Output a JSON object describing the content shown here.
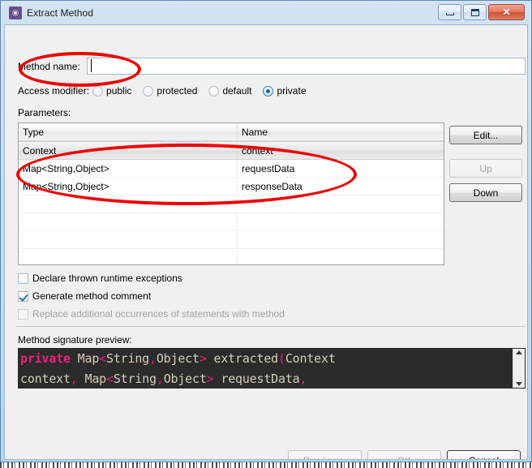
{
  "window": {
    "title": "Extract Method",
    "icon": "refactor-gear-icon",
    "controls": {
      "minimize_label": "–",
      "maximize_label": "□",
      "close_label": "✕"
    }
  },
  "method_name": {
    "label": "Method name:",
    "value": "",
    "placeholder": ""
  },
  "access_modifier": {
    "label": "Access modifier:",
    "selected": "private",
    "options": [
      {
        "label": "public",
        "checked": false
      },
      {
        "label": "protected",
        "checked": false
      },
      {
        "label": "default",
        "checked": false
      },
      {
        "label": "private",
        "checked": true
      }
    ]
  },
  "parameters": {
    "label": "Parameters:",
    "columns": [
      "Type",
      "Name"
    ],
    "rows": [
      {
        "type": "Context",
        "name": "context",
        "selected": true
      },
      {
        "type": "Map<String,Object>",
        "name": "requestData",
        "selected": false
      },
      {
        "type": "Map<String,Object>",
        "name": "responseData",
        "selected": false
      }
    ],
    "buttons": [
      {
        "label": "Edit...",
        "enabled": true
      },
      {
        "label": "Up",
        "enabled": false
      },
      {
        "label": "Down",
        "enabled": true
      }
    ]
  },
  "options": [
    {
      "label": "Declare thrown runtime exceptions",
      "checked": false,
      "enabled": true
    },
    {
      "label": "Generate method comment",
      "checked": true,
      "enabled": true
    },
    {
      "label": "Replace additional occurrences of statements with method",
      "checked": false,
      "enabled": false
    }
  ],
  "signature_preview": {
    "label": "Method signature preview:",
    "line1_keyword": "private",
    "line1_rest": " Map<String,Object> extracted(Context",
    "line2": "context, Map<String,Object> requestData,",
    "full_text": "private Map<String,Object> extracted(Context context, Map<String,Object> requestData,",
    "keyword_color": "#ec2078",
    "text_color": "#d6cdba",
    "background_color": "#2b2b2b"
  },
  "footer_buttons": [
    {
      "label": "Preview >",
      "enabled": false,
      "default": false
    },
    {
      "label": "OK",
      "enabled": false,
      "default": false
    },
    {
      "label": "Cancel",
      "enabled": true,
      "default": true
    }
  ],
  "annotations": {
    "color": "#ee0000",
    "shapes": [
      {
        "name": "method-name-highlight",
        "target": "Method name:"
      },
      {
        "name": "parameters-highlight",
        "target": "parameter rows"
      }
    ]
  }
}
